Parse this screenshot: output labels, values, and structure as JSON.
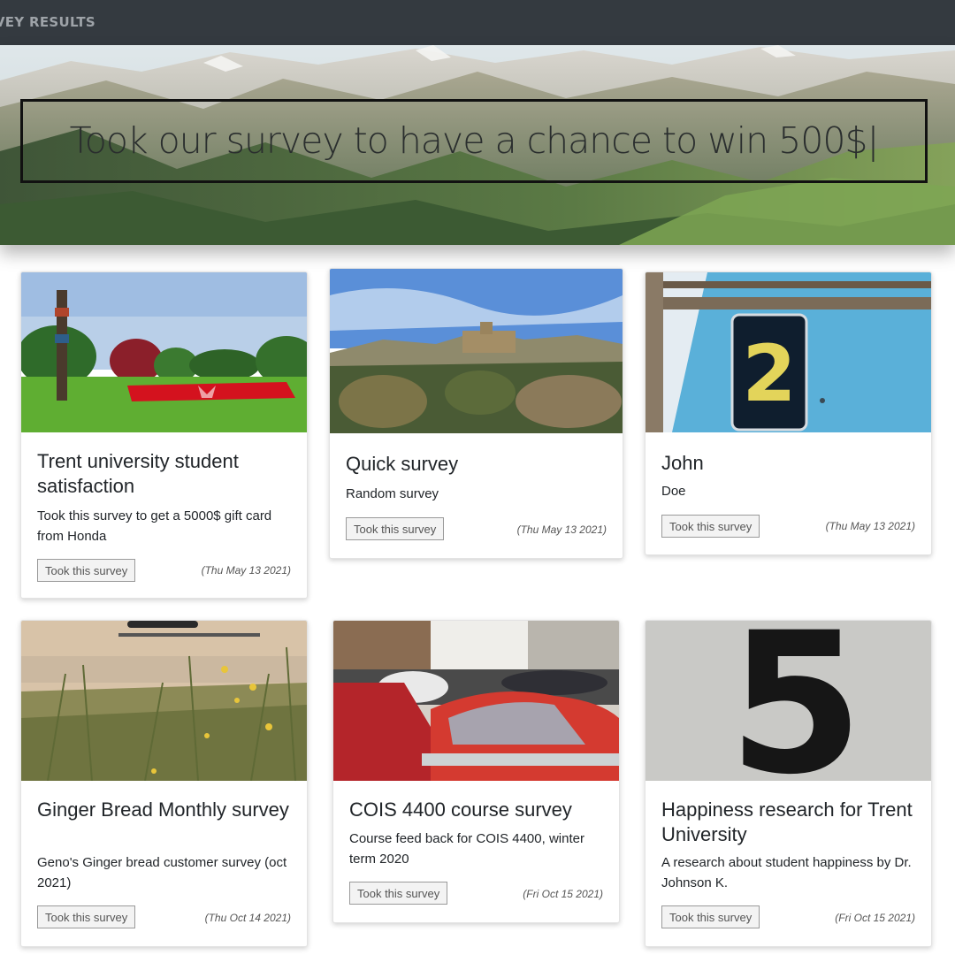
{
  "navbar": {
    "brand": "RVEY RESULTS"
  },
  "hero": {
    "headline": "Took our survey to have a chance to win 500$|"
  },
  "cards": [
    {
      "title": "Trent university student satisfaction",
      "description": "Took this survey to get a 5000$ gift card from Honda",
      "button": "Took this survey",
      "date": "(Thu May 13 2021)",
      "image": "park-with-totem-pole-and-maple-leaf-flowerbed"
    },
    {
      "title": "Quick survey",
      "description": "Random survey",
      "button": "Took this survey",
      "date": "(Thu May 13 2021)",
      "image": "hilltop-palace-with-trees"
    },
    {
      "title": "John",
      "description": "Doe",
      "button": "Took this survey",
      "date": "(Thu May 13 2021)",
      "image": "number-2-sign-on-blue-wall"
    },
    {
      "title": "Ginger Bread Monthly survey",
      "description": "Geno's Ginger bread customer survey (oct 2021)",
      "button": "Took this survey",
      "date": "(Thu Oct 14 2021)",
      "image": "wild-grass-with-yellow-flowers"
    },
    {
      "title": "COIS 4400 course survey",
      "description": "Course feed back for COIS 4400, winter term 2020",
      "button": "Took this survey",
      "date": "(Fri Oct 15 2021)",
      "image": "red-vintage-car-in-street"
    },
    {
      "title": "Happiness research for Trent University",
      "description": "A research about student happiness by Dr. Johnson K.",
      "button": "Took this survey",
      "date": "(Fri Oct 15 2021)",
      "image": "number-5-on-grey-wall"
    }
  ],
  "colors": {
    "navbar": "#343a40",
    "button_bg": "#f3f3f3",
    "text": "#212529"
  }
}
